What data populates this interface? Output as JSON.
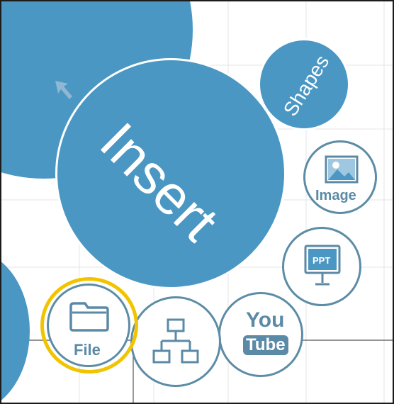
{
  "insert_menu": {
    "main_label": "Insert",
    "shapes_label": "Shapes",
    "image_label": "Image",
    "ppt_label": "PPT",
    "youtube_top": "You",
    "youtube_bottom": "Tube",
    "file_label": "File"
  },
  "colors": {
    "bubble": "#4a97c4",
    "outline": "#5c8ca6",
    "highlight": "#f2c400"
  },
  "icons": [
    "arrow-icon",
    "image-icon",
    "ppt-icon",
    "youtube-icon",
    "sitemap-icon",
    "folder-icon"
  ]
}
